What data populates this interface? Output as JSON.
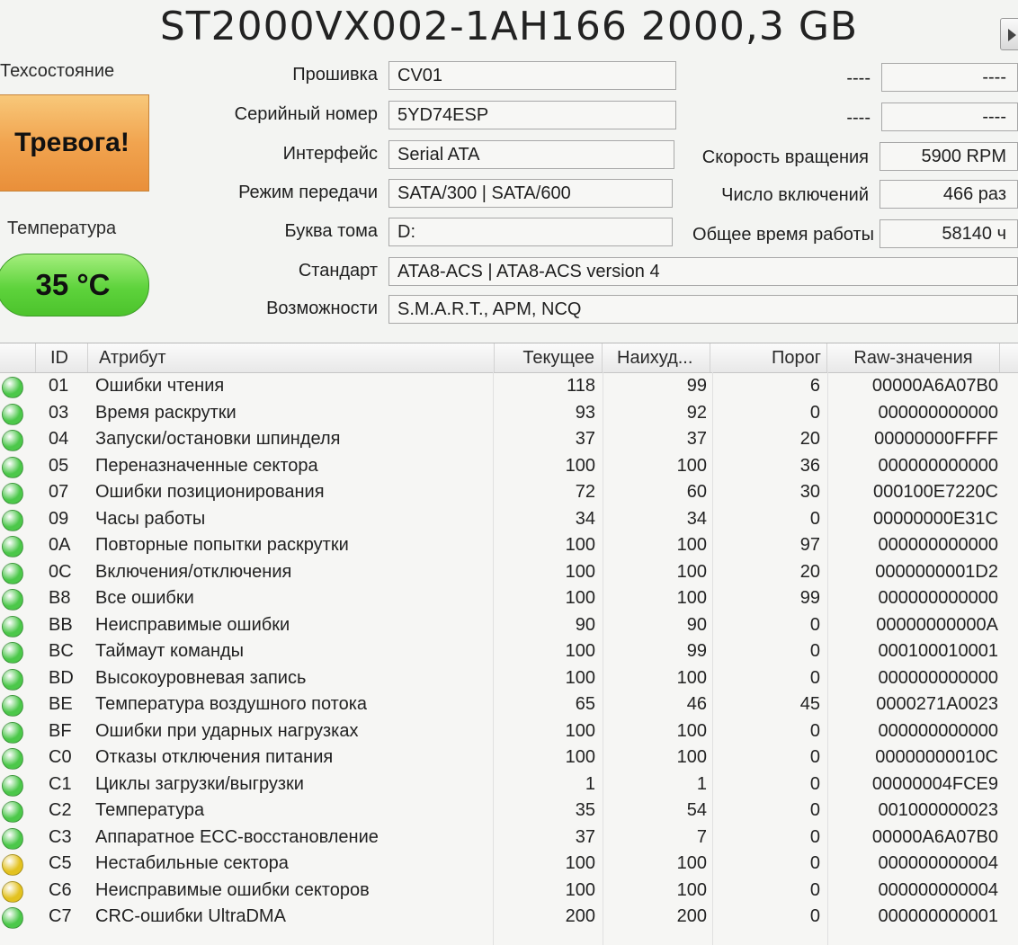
{
  "title": "ST2000VX002-1AH166 2000,3 GB",
  "health": {
    "label": "Техсостояние",
    "status": "Тревога!",
    "color": "#f1a44f"
  },
  "temperature": {
    "label": "Температура",
    "value": "35 °C",
    "color": "#5ed33c"
  },
  "fields": {
    "firmware": {
      "label": "Прошивка",
      "value": "CV01"
    },
    "serial": {
      "label": "Серийный номер",
      "value": "5YD74ESP"
    },
    "interface": {
      "label": "Интерфейс",
      "value": "Serial ATA"
    },
    "transfer_mode": {
      "label": "Режим передачи",
      "value": "SATA/300 | SATA/600"
    },
    "drive_letter": {
      "label": "Буква тома",
      "value": "D:"
    },
    "standard": {
      "label": "Стандарт",
      "value": "ATA8-ACS | ATA8-ACS version 4"
    },
    "features": {
      "label": "Возможности",
      "value": "S.M.A.R.T., APM, NCQ"
    }
  },
  "right_fields": {
    "r1": {
      "label": "----",
      "value": "----"
    },
    "r2": {
      "label": "----",
      "value": "----"
    },
    "rotation": {
      "label": "Скорость вращения",
      "value": "5900 RPM"
    },
    "power_count": {
      "label": "Число включений",
      "value": "466 раз"
    },
    "power_hours": {
      "label": "Общее время работы",
      "value": "58140 ч"
    }
  },
  "table": {
    "columns": [
      "ID",
      "Атрибут",
      "Текущее",
      "Наихуд...",
      "Порог",
      "Raw-значения"
    ],
    "status_colors": {
      "good": "#4cc84a",
      "caution": "#e3c21f"
    },
    "rows": [
      {
        "status": "good",
        "id": "01",
        "name": "Ошибки чтения",
        "current": "118",
        "worst": "99",
        "threshold": "6",
        "raw": "00000A6A07B0"
      },
      {
        "status": "good",
        "id": "03",
        "name": "Время раскрутки",
        "current": "93",
        "worst": "92",
        "threshold": "0",
        "raw": "000000000000"
      },
      {
        "status": "good",
        "id": "04",
        "name": "Запуски/остановки шпинделя",
        "current": "37",
        "worst": "37",
        "threshold": "20",
        "raw": "00000000FFFF"
      },
      {
        "status": "good",
        "id": "05",
        "name": "Переназначенные сектора",
        "current": "100",
        "worst": "100",
        "threshold": "36",
        "raw": "000000000000"
      },
      {
        "status": "good",
        "id": "07",
        "name": "Ошибки позиционирования",
        "current": "72",
        "worst": "60",
        "threshold": "30",
        "raw": "000100E7220C"
      },
      {
        "status": "good",
        "id": "09",
        "name": "Часы работы",
        "current": "34",
        "worst": "34",
        "threshold": "0",
        "raw": "00000000E31C"
      },
      {
        "status": "good",
        "id": "0A",
        "name": "Повторные попытки раскрутки",
        "current": "100",
        "worst": "100",
        "threshold": "97",
        "raw": "000000000000"
      },
      {
        "status": "good",
        "id": "0C",
        "name": "Включения/отключения",
        "current": "100",
        "worst": "100",
        "threshold": "20",
        "raw": "0000000001D2"
      },
      {
        "status": "good",
        "id": "B8",
        "name": "Все ошибки",
        "current": "100",
        "worst": "100",
        "threshold": "99",
        "raw": "000000000000"
      },
      {
        "status": "good",
        "id": "BB",
        "name": "Неисправимые ошибки",
        "current": "90",
        "worst": "90",
        "threshold": "0",
        "raw": "00000000000A"
      },
      {
        "status": "good",
        "id": "BC",
        "name": "Таймаут команды",
        "current": "100",
        "worst": "99",
        "threshold": "0",
        "raw": "000100010001"
      },
      {
        "status": "good",
        "id": "BD",
        "name": "Высокоуровневая запись",
        "current": "100",
        "worst": "100",
        "threshold": "0",
        "raw": "000000000000"
      },
      {
        "status": "good",
        "id": "BE",
        "name": "Температура воздушного потока",
        "current": "65",
        "worst": "46",
        "threshold": "45",
        "raw": "0000271A0023"
      },
      {
        "status": "good",
        "id": "BF",
        "name": "Ошибки при ударных нагрузках",
        "current": "100",
        "worst": "100",
        "threshold": "0",
        "raw": "000000000000"
      },
      {
        "status": "good",
        "id": "C0",
        "name": "Отказы отключения питания",
        "current": "100",
        "worst": "100",
        "threshold": "0",
        "raw": "00000000010C"
      },
      {
        "status": "good",
        "id": "C1",
        "name": "Циклы загрузки/выгрузки",
        "current": "1",
        "worst": "1",
        "threshold": "0",
        "raw": "00000004FCE9"
      },
      {
        "status": "good",
        "id": "C2",
        "name": "Температура",
        "current": "35",
        "worst": "54",
        "threshold": "0",
        "raw": "001000000023"
      },
      {
        "status": "good",
        "id": "C3",
        "name": "Аппаратное ECC-восстановление",
        "current": "37",
        "worst": "7",
        "threshold": "0",
        "raw": "00000A6A07B0"
      },
      {
        "status": "caution",
        "id": "C5",
        "name": "Нестабильные сектора",
        "current": "100",
        "worst": "100",
        "threshold": "0",
        "raw": "000000000004"
      },
      {
        "status": "caution",
        "id": "C6",
        "name": "Неисправимые ошибки секторов",
        "current": "100",
        "worst": "100",
        "threshold": "0",
        "raw": "000000000004"
      },
      {
        "status": "good",
        "id": "C7",
        "name": "CRC-ошибки UltraDMA",
        "current": "200",
        "worst": "200",
        "threshold": "0",
        "raw": "000000000001"
      }
    ]
  }
}
